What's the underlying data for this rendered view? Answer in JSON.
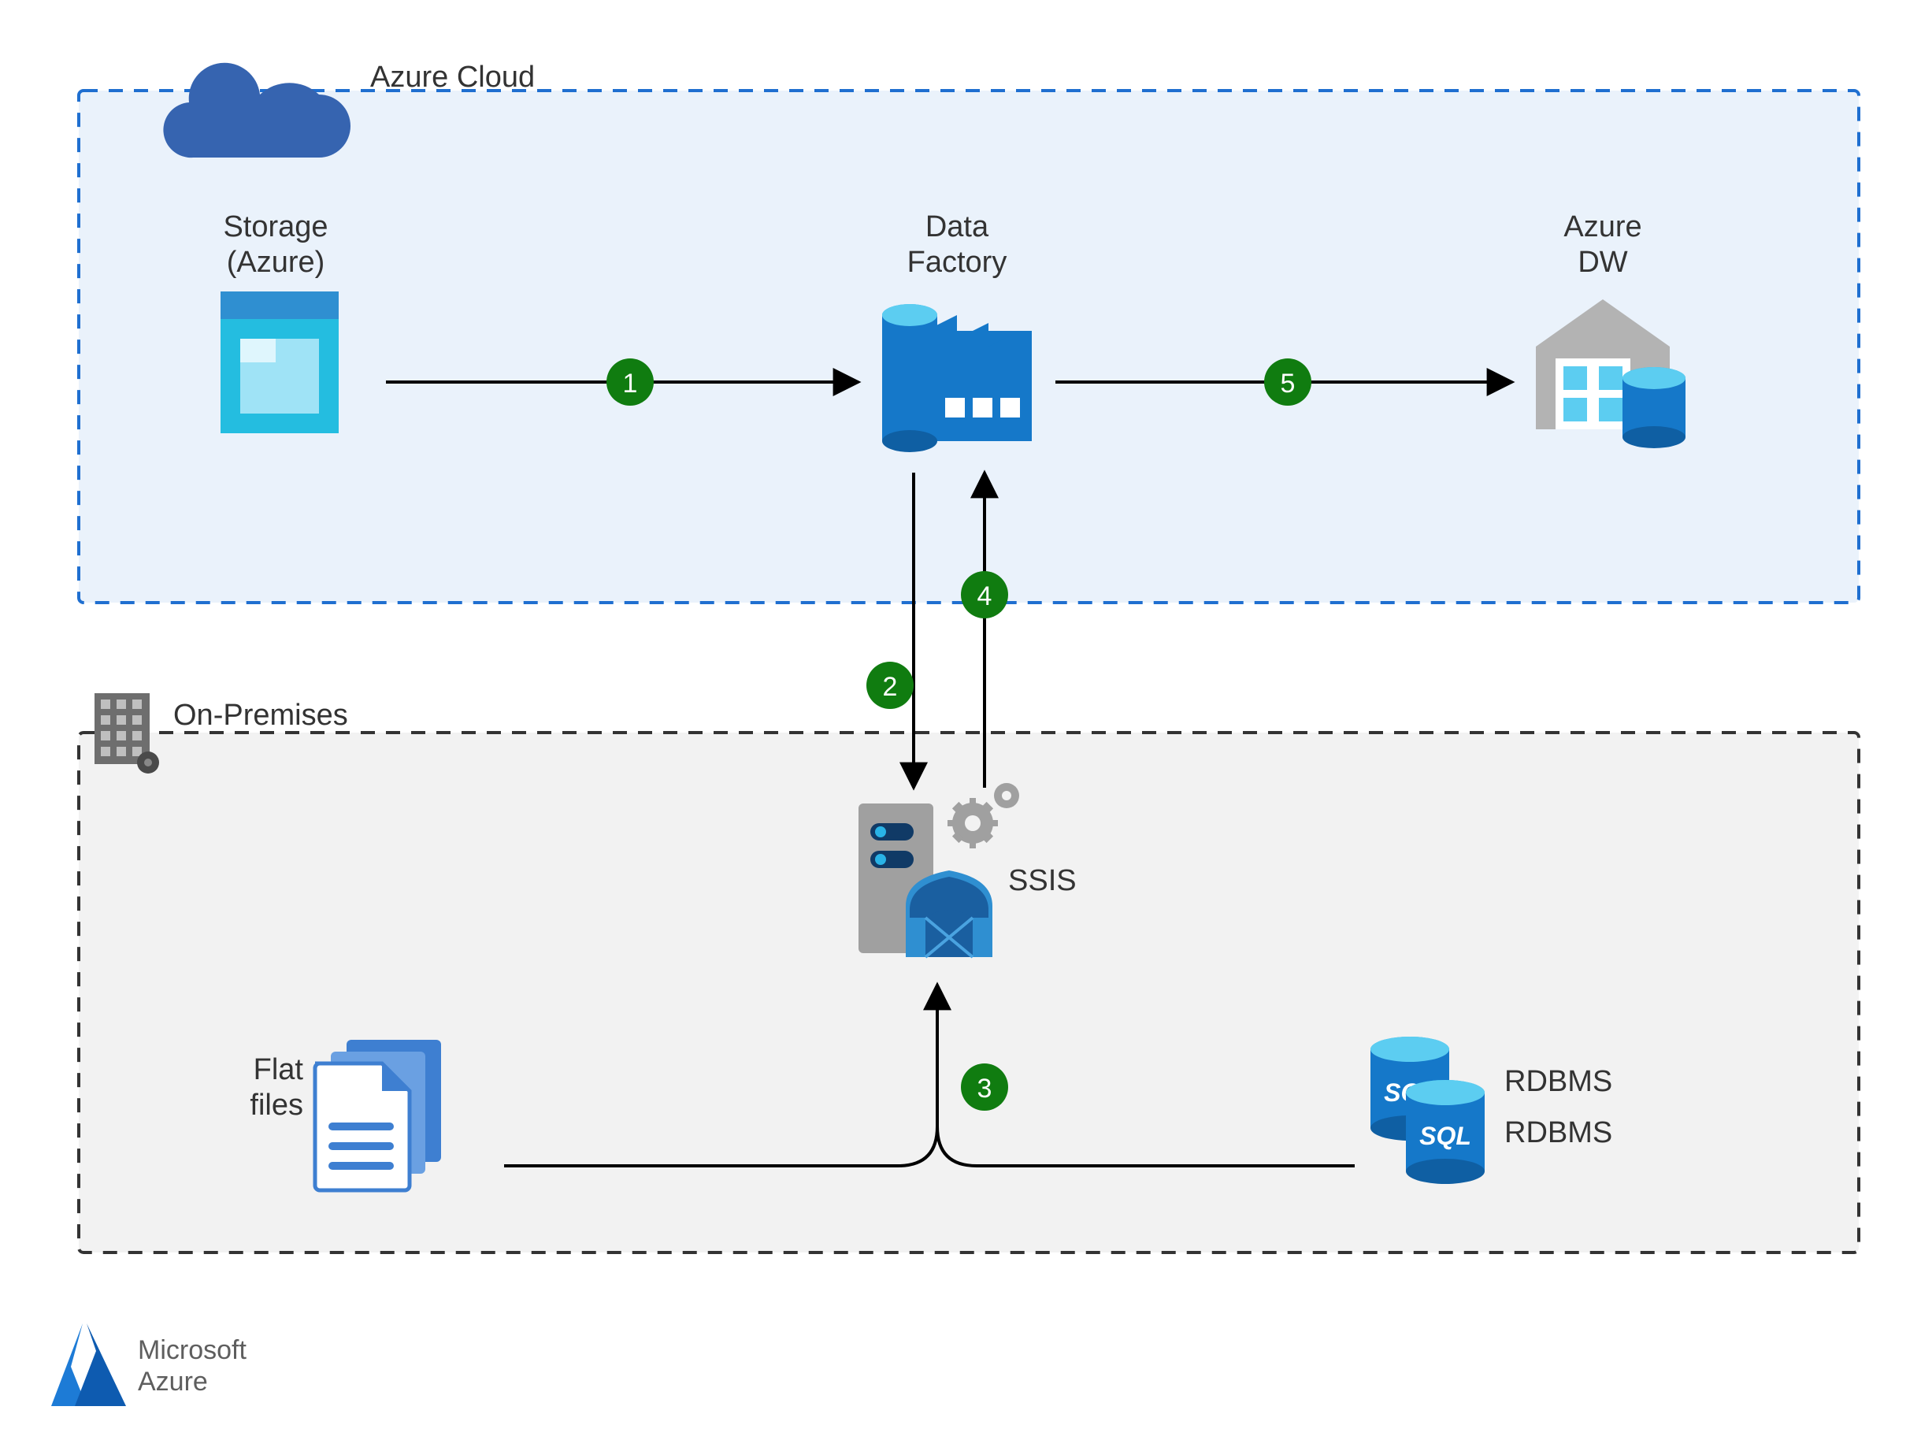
{
  "regions": {
    "cloud": {
      "title": "Azure Cloud"
    },
    "onprem": {
      "title": "On-Premises"
    }
  },
  "nodes": {
    "storage": {
      "line1": "Storage",
      "line2": "(Azure)"
    },
    "dataFactory": {
      "line1": "Data",
      "line2": "Factory"
    },
    "azureDW": {
      "line1": "Azure",
      "line2": "DW"
    },
    "ssis": {
      "label": "SSIS"
    },
    "flatFiles": {
      "line1": "Flat",
      "line2": "files"
    },
    "rdbms1": {
      "label": "RDBMS"
    },
    "rdbms2": {
      "label": "RDBMS"
    }
  },
  "steps": {
    "s1": "1",
    "s2": "2",
    "s3": "3",
    "s4": "4",
    "s5": "5"
  },
  "footer": {
    "line1": "Microsoft",
    "line2": "Azure"
  },
  "colors": {
    "azureBlue": "#0078D4",
    "lightBlueFill": "#EAF2FB",
    "greyFill": "#F2F2F2",
    "stepGreen": "#107C10",
    "darkGrey": "#5E5E5E"
  }
}
